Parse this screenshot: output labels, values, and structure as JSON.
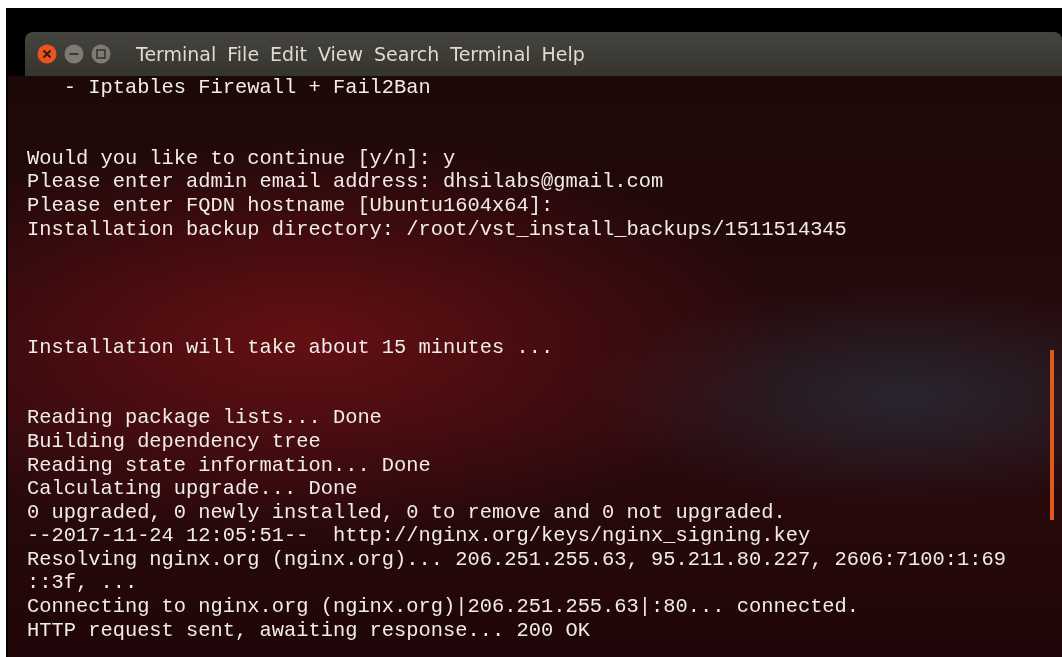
{
  "window": {
    "menu": [
      "Terminal",
      "File",
      "Edit",
      "View",
      "Search",
      "Terminal",
      "Help"
    ]
  },
  "terminal": {
    "lines": [
      {
        "kind": "text",
        "text": "   - Iptables Firewall + Fail2Ban"
      },
      {
        "kind": "blank"
      },
      {
        "kind": "blank"
      },
      {
        "kind": "text",
        "text": "Would you like to continue [y/n]: y"
      },
      {
        "kind": "text",
        "text": "Please enter admin email address: dhsilabs@gmail.com"
      },
      {
        "kind": "text",
        "text": "Please enter FQDN hostname [Ubuntu1604x64]:"
      },
      {
        "kind": "text",
        "text": "Installation backup directory: /root/vst_install_backups/1511514345"
      },
      {
        "kind": "blank"
      },
      {
        "kind": "blank"
      },
      {
        "kind": "blank"
      },
      {
        "kind": "blank"
      },
      {
        "kind": "text",
        "text": "Installation will take about 15 minutes ..."
      },
      {
        "kind": "blank"
      },
      {
        "kind": "blank"
      },
      {
        "kind": "text",
        "text": "Reading package lists... Done"
      },
      {
        "kind": "text",
        "text": "Building dependency tree"
      },
      {
        "kind": "text",
        "text": "Reading state information... Done"
      },
      {
        "kind": "text",
        "text": "Calculating upgrade... Done"
      },
      {
        "kind": "text",
        "text": "0 upgraded, 0 newly installed, 0 to remove and 0 not upgraded."
      },
      {
        "kind": "text",
        "text": "--2017-11-24 12:05:51--  http://nginx.org/keys/nginx_signing.key"
      },
      {
        "kind": "text",
        "text": "Resolving nginx.org (nginx.org)... 206.251.255.63, 95.211.80.227, 2606:7100:1:69"
      },
      {
        "kind": "text",
        "text": "::3f, ..."
      },
      {
        "kind": "text",
        "text": "Connecting to nginx.org (nginx.org)|206.251.255.63|:80... connected."
      },
      {
        "kind": "text",
        "text": "HTTP request sent, awaiting response... 200 OK"
      }
    ]
  }
}
